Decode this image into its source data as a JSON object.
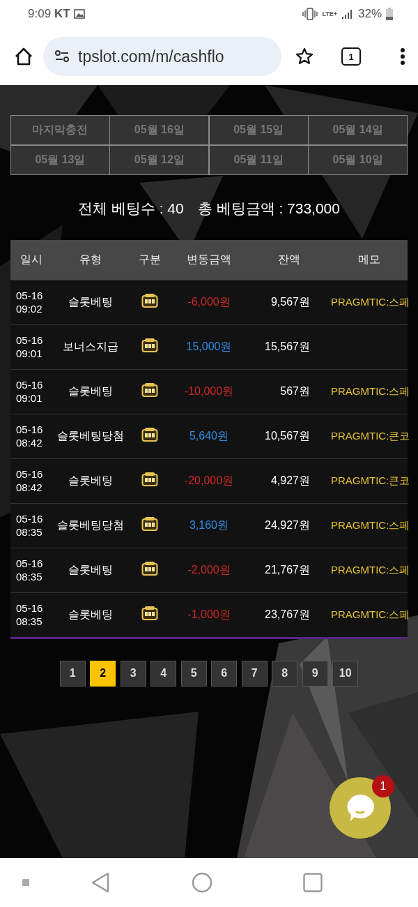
{
  "status_bar": {
    "time": "9:09",
    "carrier": "KT",
    "network": "LTE+",
    "battery": "32%"
  },
  "browser": {
    "url": "tpslot.com/m/cashflo",
    "tab_count": "1"
  },
  "date_filters": [
    {
      "label": "마지막충전",
      "selected": false
    },
    {
      "label": "05월 16일",
      "selected": false
    },
    {
      "label": "05월 15일",
      "selected": false
    },
    {
      "label": "05월 14일",
      "selected": false
    },
    {
      "label": "05월 13일",
      "selected": false
    },
    {
      "label": "05월 12일",
      "selected": false
    },
    {
      "label": "05월 11일",
      "selected": false
    },
    {
      "label": "05월 10일",
      "selected": false
    }
  ],
  "summary": {
    "count_label": "전체 베팅수 : 40",
    "total_label": "총 베팅금액 : 733,000"
  },
  "table": {
    "columns": [
      "일시",
      "유형",
      "구분",
      "변동금액",
      "잔액",
      "메모"
    ],
    "rows": [
      {
        "datetime": "05-16 09:02",
        "type": "슬롯베팅",
        "amount": "-6,000원",
        "kind": "debit",
        "balance": "9,567원",
        "memo": "PRAGMTIC:스페"
      },
      {
        "datetime": "05-16 09:01",
        "type": "보너스지급",
        "amount": "15,000원",
        "kind": "credit",
        "balance": "15,567원"
      },
      {
        "datetime": "05-16 09:01",
        "type": "슬롯베팅",
        "amount": "-10,000원",
        "kind": "debit",
        "balance": "567원",
        "memo": "PRAGMTIC:스페"
      },
      {
        "datetime": "05-16 08:42",
        "type": "슬롯베팅당첨",
        "amount": "5,640원",
        "kind": "credit",
        "balance": "10,567원",
        "memo": "PRAGMTIC:큰코"
      },
      {
        "datetime": "05-16 08:42",
        "type": "슬롯베팅",
        "amount": "-20,000원",
        "kind": "debit",
        "balance": "4,927원",
        "memo": "PRAGMTIC:큰코"
      },
      {
        "datetime": "05-16 08:35",
        "type": "슬롯베팅당첨",
        "amount": "3,160원",
        "kind": "credit",
        "balance": "24,927원",
        "memo": "PRAGMTIC:스페"
      },
      {
        "datetime": "05-16 08:35",
        "type": "슬롯베팅",
        "amount": "-2,000원",
        "kind": "debit",
        "balance": "21,767원",
        "memo": "PRAGMTIC:스페"
      },
      {
        "datetime": "05-16 08:35",
        "type": "슬롯베팅",
        "amount": "-1,000원",
        "kind": "debit",
        "balance": "23,767원",
        "memo": "PRAGMTIC:스페"
      }
    ]
  },
  "pagination": [
    {
      "label": "1",
      "selected": false
    },
    {
      "label": "2",
      "selected": true
    },
    {
      "label": "3",
      "selected": false
    },
    {
      "label": "4",
      "selected": false
    },
    {
      "label": "5",
      "selected": false
    },
    {
      "label": "6",
      "selected": false
    },
    {
      "label": "7",
      "selected": false
    },
    {
      "label": "8",
      "selected": false
    },
    {
      "label": "9",
      "selected": false
    },
    {
      "label": "10",
      "selected": false
    }
  ],
  "chat": {
    "badge": "1"
  }
}
